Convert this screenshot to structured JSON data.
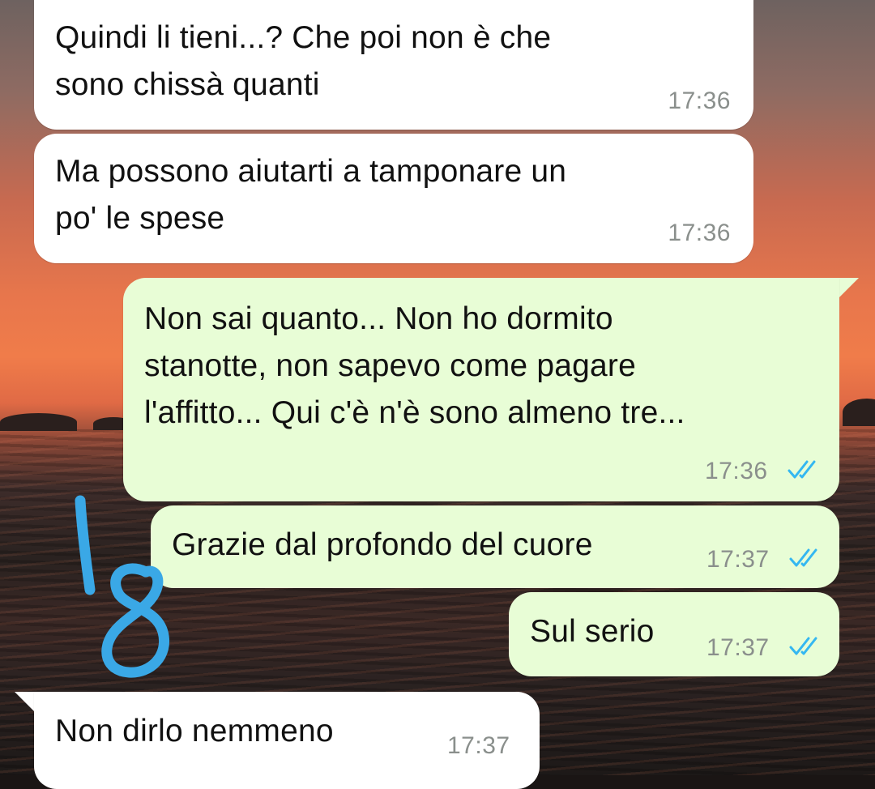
{
  "colors": {
    "incoming_bubble": "#ffffff",
    "outgoing_bubble": "#e8fdd6",
    "read_ticks": "#34b7f1",
    "annotation": "#3aa8e6"
  },
  "annotation": {
    "drawing": "hand-drawn number 18",
    "value": "18"
  },
  "messages": [
    {
      "direction": "incoming",
      "text": "Quindi li tieni...? Che poi non è che\nsono chissà quanti",
      "time": "17:36"
    },
    {
      "direction": "incoming",
      "text": "Ma possono aiutarti a tamponare un\npo' le spese",
      "time": "17:36"
    },
    {
      "direction": "outgoing",
      "text": "Non sai quanto... Non ho dormito\nstanotte, non sapevo come pagare\nl'affitto... Qui c'è n'è sono almeno tre...",
      "time": "17:36",
      "status_icon": "double-check-read-icon"
    },
    {
      "direction": "outgoing",
      "text": "Grazie dal profondo del cuore",
      "time": "17:37",
      "status_icon": "double-check-read-icon"
    },
    {
      "direction": "outgoing",
      "text": "Sul serio",
      "time": "17:37",
      "status_icon": "double-check-read-icon"
    },
    {
      "direction": "incoming",
      "text": "Non dirlo nemmeno",
      "time": "17:37"
    }
  ]
}
